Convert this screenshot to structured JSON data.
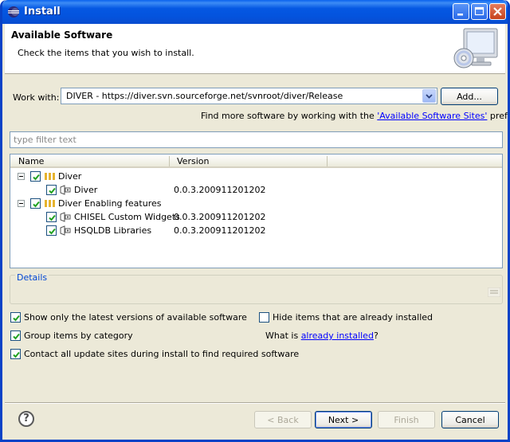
{
  "window": {
    "title": "Install"
  },
  "header": {
    "title": "Available Software",
    "description": "Check the items that you wish to install."
  },
  "work_with": {
    "label": "Work with:",
    "value": "DIVER - https://diver.svn.sourceforge.net/svnroot/diver/Release",
    "add_label": "Add...",
    "more_text_prefix": "Find more software by working with the ",
    "more_link": "'Available Software Sites'",
    "more_text_suffix": " preferences."
  },
  "filter": {
    "placeholder": "type filter text"
  },
  "tree": {
    "columns": [
      "Name",
      "Version"
    ],
    "rows": [
      {
        "name": "Diver",
        "version": "",
        "checked": true
      },
      {
        "name": "Diver",
        "version": "0.0.3.200911201202",
        "checked": true
      },
      {
        "name": "Diver Enabling features",
        "version": "",
        "checked": true
      },
      {
        "name": "CHISEL Custom Widgets",
        "version": "0.0.3.200911201202",
        "checked": true
      },
      {
        "name": "HSQLDB Libraries",
        "version": "0.0.3.200911201202",
        "checked": true
      }
    ]
  },
  "details": {
    "label": "Details"
  },
  "options": {
    "show_latest": {
      "label": "Show only the latest versions of available software",
      "checked": true
    },
    "hide_installed": {
      "label": "Hide items that are already installed",
      "checked": false
    },
    "group_category": {
      "label": "Group items by category",
      "checked": true
    },
    "what_is_prefix": "What is ",
    "already_installed_link": "already installed",
    "what_is_suffix": "?",
    "contact_sites": {
      "label": "Contact all update sites during install to find required software",
      "checked": true
    }
  },
  "buttons": {
    "back": "< Back",
    "next": "Next >",
    "finish": "Finish",
    "cancel": "Cancel",
    "help": "?"
  },
  "colors": {
    "titlebar": "#0558e3",
    "dialog_bg": "#ece9d8",
    "link": "#0000ff",
    "details_label": "#0046d5",
    "check": "#21a121"
  }
}
